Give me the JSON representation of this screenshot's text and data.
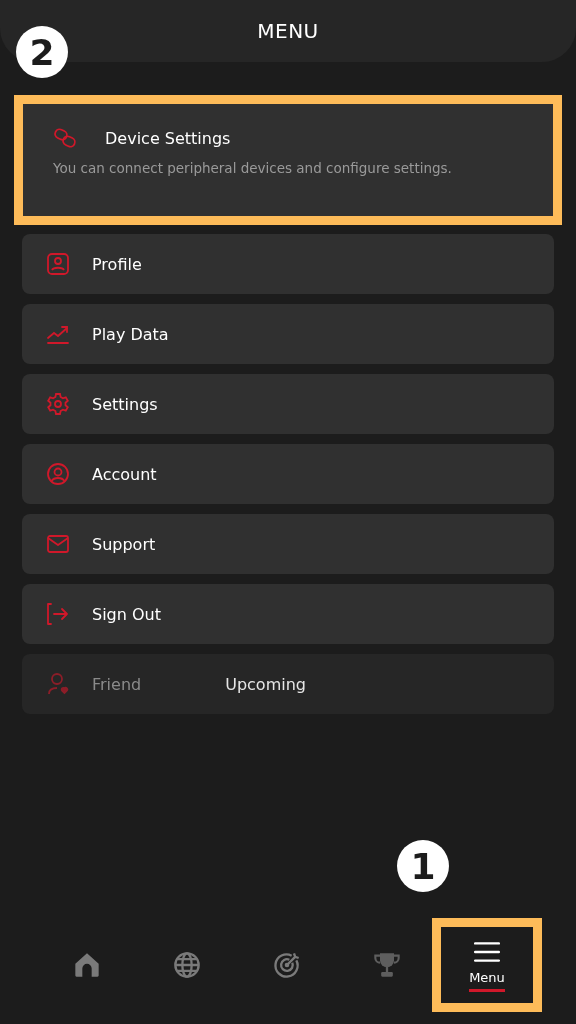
{
  "header": {
    "title": "MENU"
  },
  "callouts": [
    {
      "label": "2"
    },
    {
      "label": "1"
    }
  ],
  "menu_items": [
    {
      "kind": "featured",
      "label": "Device Settings",
      "description": "You can connect peripheral devices and configure settings.",
      "highlighted": true,
      "disabled": false
    },
    {
      "kind": "item",
      "label": "Profile",
      "highlighted": false,
      "disabled": false
    },
    {
      "kind": "item",
      "label": "Play Data",
      "highlighted": false,
      "disabled": false
    },
    {
      "kind": "item",
      "label": "Settings",
      "highlighted": false,
      "disabled": false
    },
    {
      "kind": "item",
      "label": "Account",
      "highlighted": false,
      "disabled": false
    },
    {
      "kind": "item",
      "label": "Support",
      "highlighted": false,
      "disabled": false
    },
    {
      "kind": "item",
      "label": "Sign Out",
      "highlighted": false,
      "disabled": false
    },
    {
      "kind": "item",
      "label": "Friend",
      "badge": "Upcoming",
      "highlighted": false,
      "disabled": true
    }
  ],
  "nav": [
    {
      "selected": false,
      "highlighted": false
    },
    {
      "selected": false,
      "highlighted": false
    },
    {
      "selected": false,
      "highlighted": false
    },
    {
      "selected": false,
      "highlighted": false
    },
    {
      "label": "Menu",
      "selected": true,
      "highlighted": true
    }
  ]
}
